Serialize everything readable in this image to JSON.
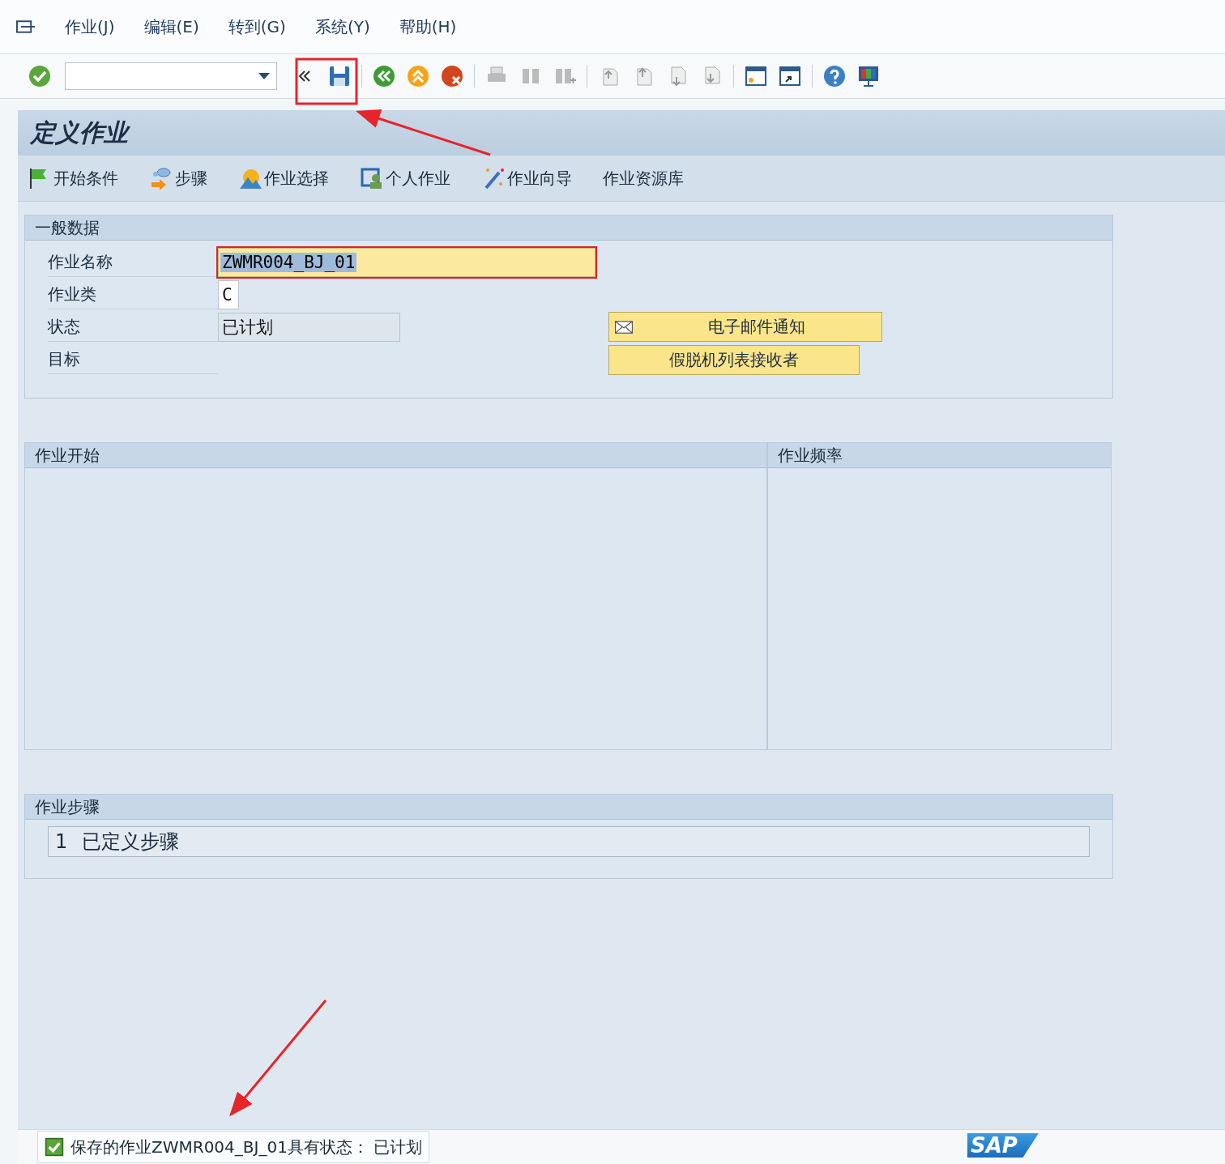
{
  "menu": [
    {
      "label": "作业(J)"
    },
    {
      "label": "编辑(E)"
    },
    {
      "label": "转到(G)"
    },
    {
      "label": "系统(Y)"
    },
    {
      "label": "帮助(H)"
    }
  ],
  "title": "定义作业",
  "app_toolbar": [
    {
      "label": "开始条件",
      "kind": "flag"
    },
    {
      "label": "步骤",
      "kind": "steps"
    },
    {
      "label": "作业选择",
      "kind": "mountain"
    },
    {
      "label": "个人作业",
      "kind": "person"
    },
    {
      "label": "作业向导",
      "kind": "wand"
    },
    {
      "label": "作业资源库",
      "kind": "none"
    }
  ],
  "general": {
    "title": "一般数据",
    "fields": [
      {
        "label": "作业名称",
        "value": "ZWMR004_BJ_01",
        "kind": "input",
        "focused": true,
        "text_selected": true
      },
      {
        "label": "作业类",
        "value": "C",
        "kind": "short"
      },
      {
        "label": "状态",
        "value": "已计划",
        "kind": "display"
      },
      {
        "label": "目标",
        "kind": "blank"
      }
    ],
    "buttons": [
      {
        "label": "电子邮件通知",
        "kind": "mail"
      },
      {
        "label": "假脱机列表接收者",
        "kind": "plain"
      }
    ]
  },
  "start_panel": {
    "title": "作业开始"
  },
  "frequency_panel": {
    "title": "作业频率"
  },
  "steps": {
    "title": "作业步骤",
    "number": "1",
    "text": "已定义步骤"
  },
  "status": {
    "kind": "success",
    "message": "保存的作业ZWMR004_BJ_01具有状态： 已计划"
  },
  "logo": "SAP"
}
